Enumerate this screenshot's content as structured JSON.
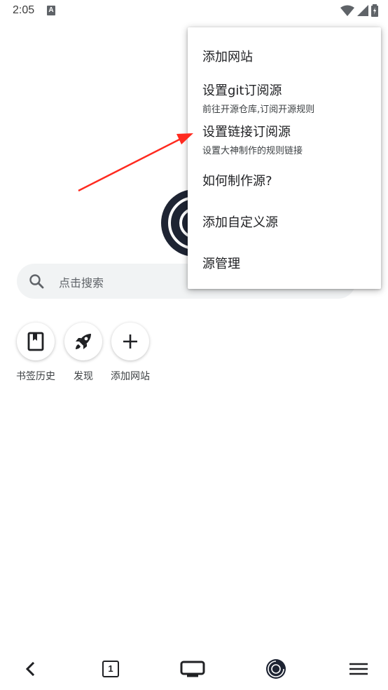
{
  "status_bar": {
    "time": "2:05",
    "notification_icon": "A"
  },
  "search": {
    "placeholder": "点击搜索",
    "icon": "search-icon"
  },
  "shortcuts": [
    {
      "label": "书签历史",
      "icon": "bookmark-icon"
    },
    {
      "label": "发现",
      "icon": "rocket-icon"
    },
    {
      "label": "添加网站",
      "icon": "plus-icon"
    }
  ],
  "menu": {
    "items": [
      {
        "title": "添加网站",
        "subtitle": ""
      },
      {
        "title": "设置git订阅源",
        "subtitle": "前往开源仓库,订阅开源规则"
      },
      {
        "title": "设置链接订阅源",
        "subtitle": "设置大神制作的规则链接"
      },
      {
        "title": "如何制作源?",
        "subtitle": ""
      },
      {
        "title": "添加自定义源",
        "subtitle": ""
      },
      {
        "title": "源管理",
        "subtitle": ""
      }
    ]
  },
  "bottom_nav": {
    "tab_count": "1",
    "icons": [
      "back-icon",
      "tabs-icon",
      "tv-icon",
      "home-logo-icon",
      "menu-icon"
    ]
  },
  "colors": {
    "arrow": "#ff2a1f",
    "search_bg": "#f1f3f4",
    "logo_dark": "#1e2433"
  }
}
